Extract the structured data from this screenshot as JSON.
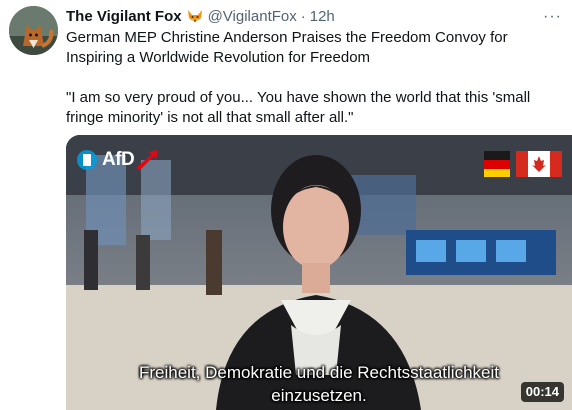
{
  "tweet": {
    "author_name": "The Vigilant Fox",
    "badge_icon": "fox-emoji",
    "handle": "@VigilantFox",
    "separator": "·",
    "time": "12h",
    "more_icon": "more-horizontal-icon",
    "more_label": "···",
    "text_line1": "German MEP Christine Anderson Praises the Freedom Convoy for Inspiring a Worldwide Revolution for Freedom",
    "text_quote": "\"I am so very proud of you... You have shown the world that this 'small fringe minority' is not all that small after all.\""
  },
  "video": {
    "logo_text": "AfD",
    "flags": [
      "germany-flag-icon",
      "canada-flag-icon"
    ],
    "subtitle_line1": "Freiheit, Demokratie und die Rechtsstaatlichkeit",
    "subtitle_line2": "einzusetzen.",
    "duration": "00:14"
  },
  "colors": {
    "text_primary": "#0f1419",
    "text_secondary": "#536471",
    "afd_red": "#e30613",
    "afd_blue": "#009ee0"
  }
}
